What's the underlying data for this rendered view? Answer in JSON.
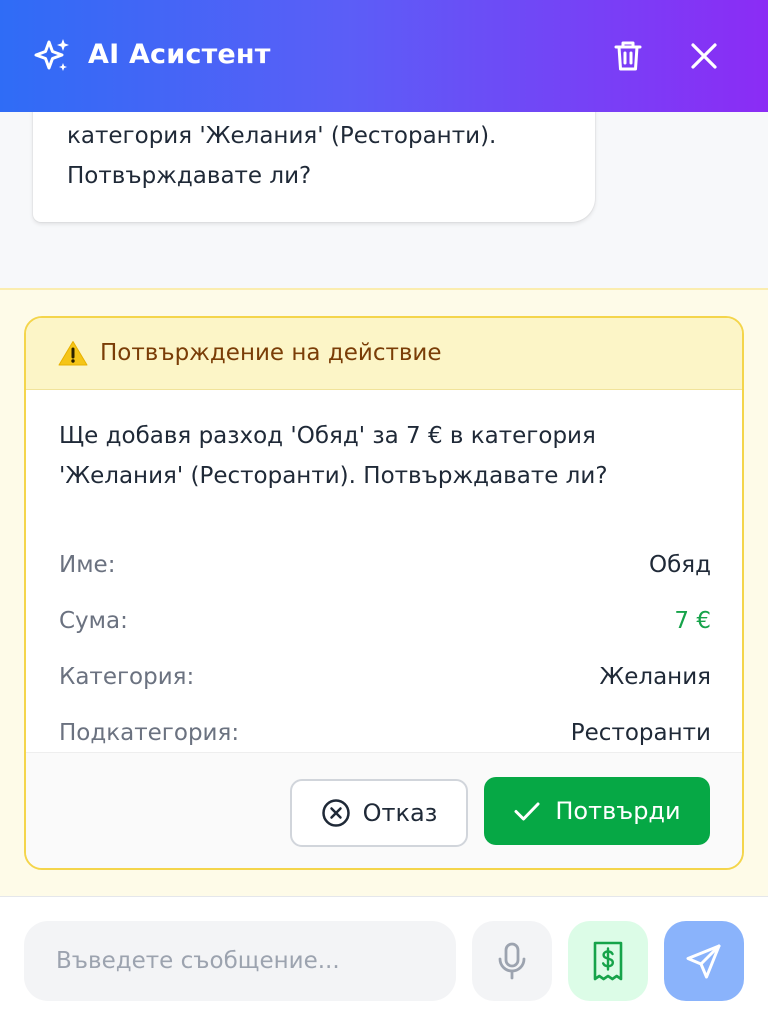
{
  "header": {
    "title": "AI Асистент",
    "icons": {
      "assistant": "sparkles-icon",
      "clear": "trash-icon",
      "close": "close-icon"
    },
    "gradient_colors": [
      "#2f6cf6",
      "#8b2cf5"
    ]
  },
  "chat": {
    "assistant_message_line1": "категория 'Желания' (Ресторанти).",
    "assistant_message_line2": "Потвърждавате ли?"
  },
  "confirmation": {
    "title": "Потвърждение на действие",
    "message_line1": "Ще добавя разход 'Обяд' за 7 € в категория",
    "message_line2": "'Желания' (Ресторанти). Потвърждавате ли?",
    "fields": [
      {
        "label": "Име:",
        "value": "Обяд"
      },
      {
        "label": "Сума:",
        "value": "7 €",
        "color": "#16a34a"
      },
      {
        "label": "Категория:",
        "value": "Желания"
      },
      {
        "label": "Подкатегория:",
        "value": "Ресторанти"
      }
    ],
    "cancel_label": "Отказ",
    "confirm_label": "Потвърди",
    "confirm_color": "#06a845",
    "warning_color": "#f5c518"
  },
  "input": {
    "placeholder": "Въведете съобщение...",
    "value": "",
    "icons": {
      "mic": "microphone-icon",
      "receipt": "receipt-icon",
      "send": "send-icon"
    }
  }
}
